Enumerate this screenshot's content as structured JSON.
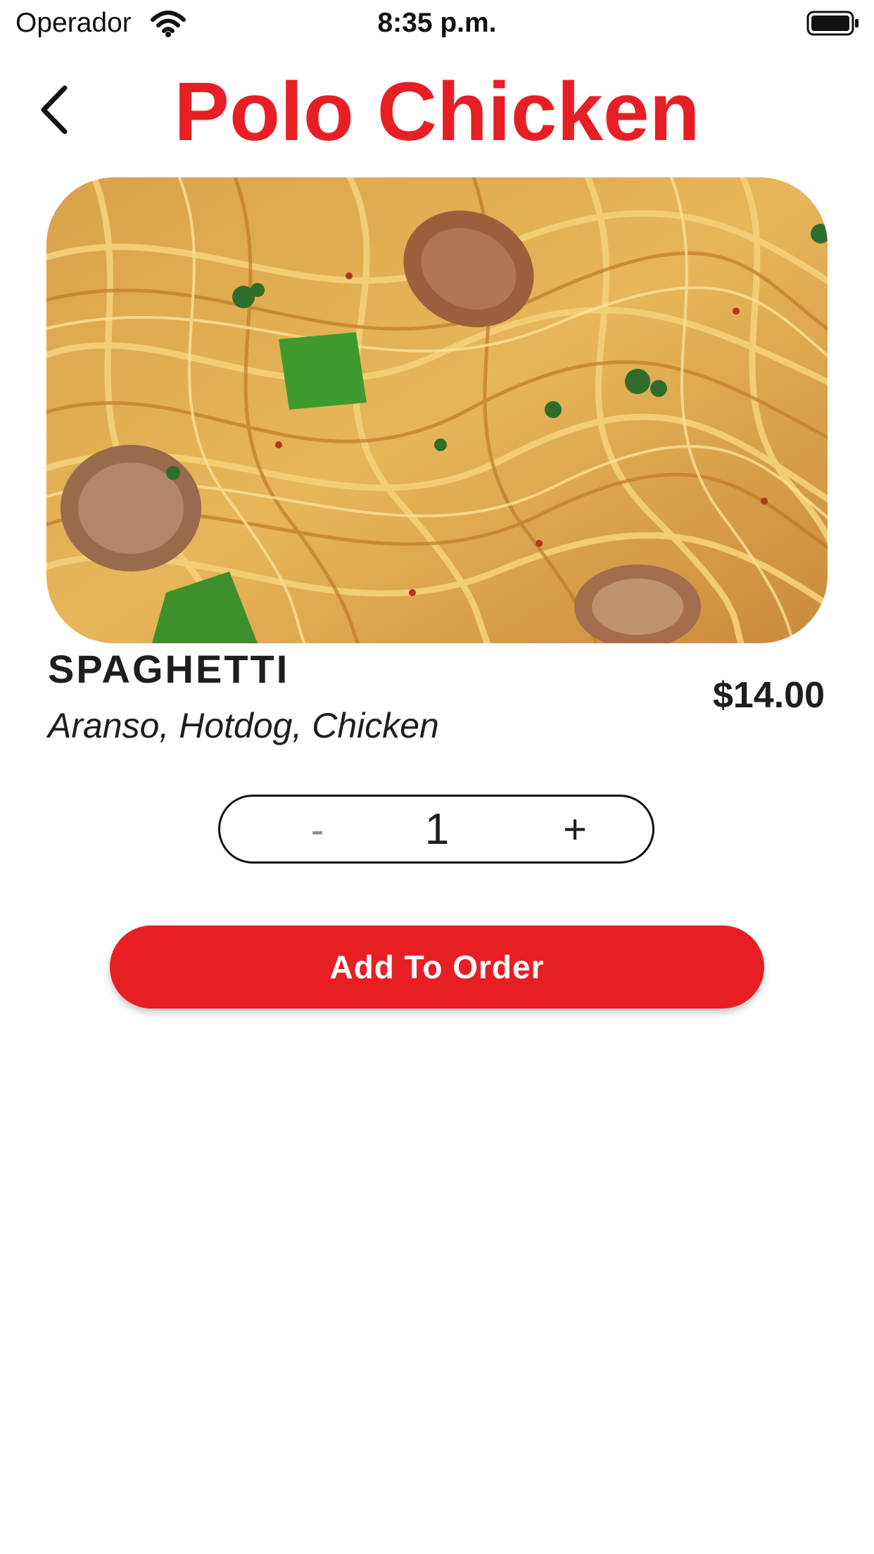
{
  "status_bar": {
    "carrier": "Operador",
    "time": "8:35 p.m.",
    "wifi_icon": "wifi-icon",
    "battery_icon": "battery-icon"
  },
  "header": {
    "title": "Polo Chicken",
    "back_icon": "chevron-left-icon"
  },
  "colors": {
    "brand_red": "#e81e25",
    "text_dark": "#1e1e1e"
  },
  "item": {
    "image_icon": "food-photo-spaghetti",
    "name": "SPAGHETTI",
    "description": "Aranso, Hotdog, Chicken",
    "price": "$14.00"
  },
  "quantity": {
    "minus_label": "-",
    "value": "1",
    "plus_label": "+"
  },
  "actions": {
    "add_label": "Add To Order"
  }
}
